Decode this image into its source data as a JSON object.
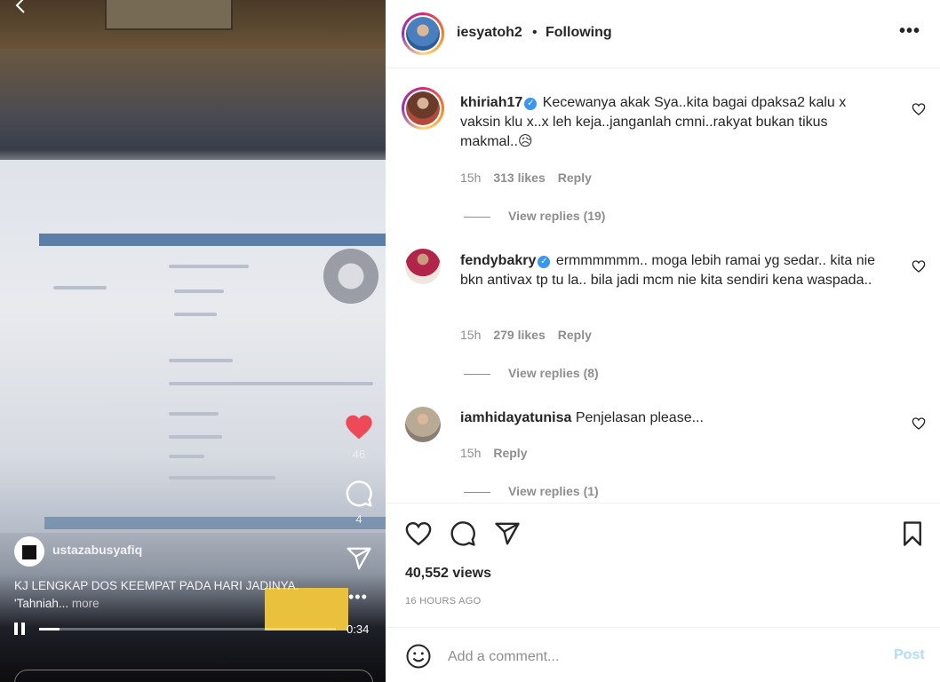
{
  "video": {
    "back_icon": "chevron-left-icon",
    "like_count": "46",
    "comment_count": "4",
    "poster_username": "ustazabusyafiq",
    "caption_line1": "KJ LENGKAP DOS KEEMPAT PADA HARI JADINYA.",
    "caption_line2": "'Tahniah...",
    "caption_more": "more",
    "time_remaining": "0:34",
    "progress_fraction": 0.07,
    "heart_color": "#ed4956"
  },
  "header": {
    "username": "iesyatoh2",
    "separator": "•",
    "follow_status": "Following",
    "more_icon": "•••"
  },
  "comments": [
    {
      "username": "khiriah17",
      "verified": true,
      "text": "Kecewanya akak Sya..kita bagai dpaksa2 kalu x vaksin klu x..x leh keja..janganlah cmni..rakyat bukan tikus makmal..😥",
      "time": "15h",
      "likes": "313 likes",
      "reply": "Reply",
      "view_replies": "View replies (19)"
    },
    {
      "username": "fendybakry",
      "verified": true,
      "text": "ermmmmmm.. moga lebih ramai yg sedar.. kita nie bkn antivax tp tu la.. bila jadi mcm nie kita sendiri kena waspada..",
      "time": "15h",
      "likes": "279 likes",
      "reply": "Reply",
      "view_replies": "View replies (8)"
    },
    {
      "username": "iamhidayatunisa",
      "verified": false,
      "text": "Penjelasan please...",
      "time": "15h",
      "likes": "",
      "reply": "Reply",
      "view_replies": "View replies (1)"
    }
  ],
  "stats": {
    "views": "40,552 views",
    "posted_ago": "16 HOURS AGO"
  },
  "add_comment": {
    "placeholder": "Add a comment...",
    "post_label": "Post"
  },
  "colors": {
    "verified_blue": "#3897f0",
    "post_disabled": "#b3dbff",
    "meta_gray": "#8e8e8e"
  }
}
